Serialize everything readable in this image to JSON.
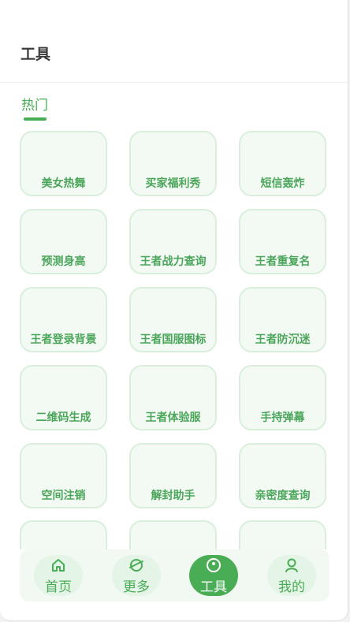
{
  "header": {
    "title": "工具"
  },
  "tabs": [
    {
      "label": "热门"
    }
  ],
  "tools": [
    {
      "label": "美女热舞"
    },
    {
      "label": "买家福利秀"
    },
    {
      "label": "短信轰炸"
    },
    {
      "label": "预测身高"
    },
    {
      "label": "王者战力查询"
    },
    {
      "label": "王者重复名"
    },
    {
      "label": "王者登录背景"
    },
    {
      "label": "王者国服图标"
    },
    {
      "label": "王者防沉迷"
    },
    {
      "label": "二维码生成"
    },
    {
      "label": "王者体验服"
    },
    {
      "label": "手持弹幕"
    },
    {
      "label": "空间注销"
    },
    {
      "label": "解封助手"
    },
    {
      "label": "亲密度查询"
    },
    {
      "label": ""
    },
    {
      "label": ""
    },
    {
      "label": ""
    }
  ],
  "nav": {
    "items": [
      {
        "label": "首页",
        "icon": "home-icon"
      },
      {
        "label": "更多",
        "icon": "planet-icon"
      },
      {
        "label": "工具",
        "icon": "tool-icon"
      },
      {
        "label": "我的",
        "icon": "user-icon"
      }
    ],
    "active": "工具"
  },
  "colors": {
    "accent": "#49ad55",
    "card_border": "#d9efdc",
    "card_bg": "#f3faf4",
    "nav_bg": "#f1f9f2"
  }
}
